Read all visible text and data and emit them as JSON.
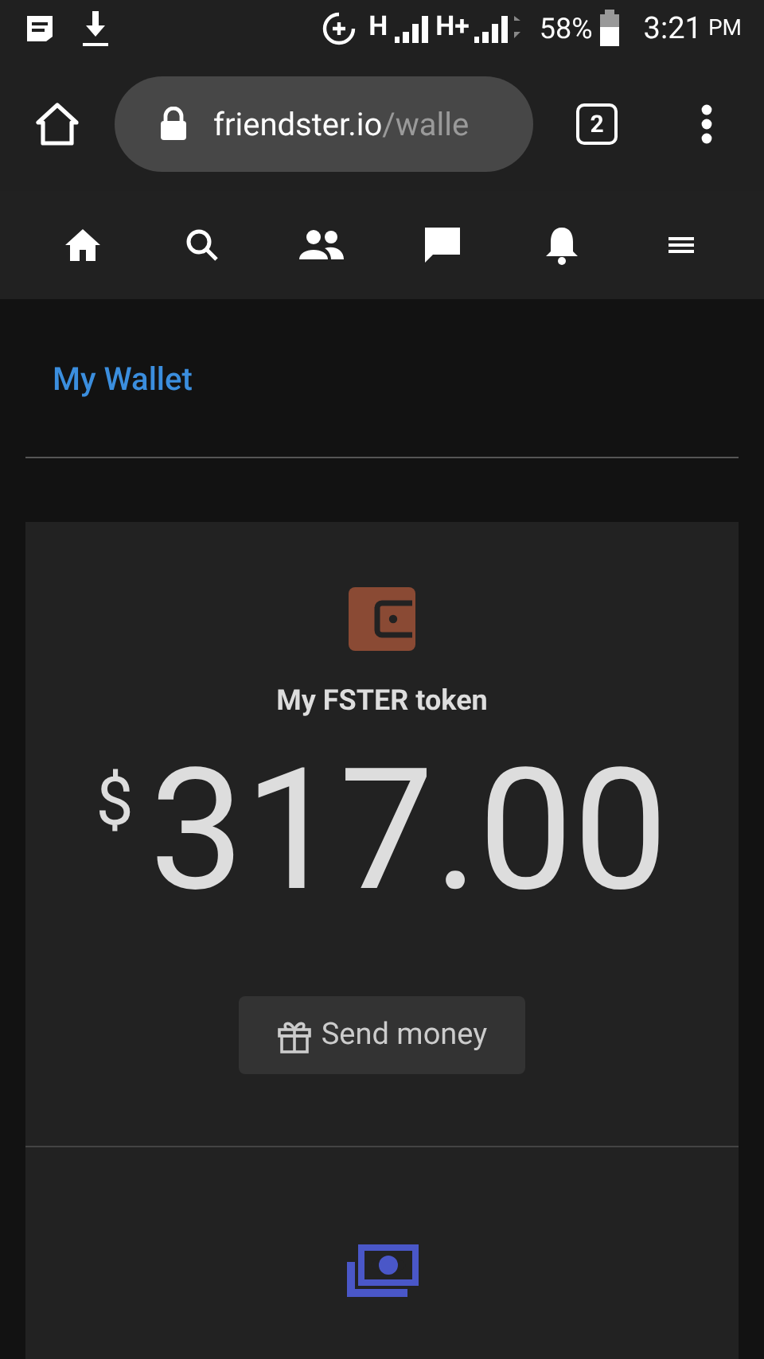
{
  "status_bar": {
    "network_1": "H",
    "network_2": "H+",
    "battery": "58%",
    "time": "3:21",
    "period": "PM"
  },
  "browser": {
    "url_domain": "friendster.io",
    "url_path": "/walle",
    "tab_count": "2"
  },
  "nav": [
    {
      "kind": "home"
    },
    {
      "kind": "search"
    },
    {
      "kind": "friends"
    },
    {
      "kind": "messages"
    },
    {
      "kind": "notifications"
    },
    {
      "kind": "menu"
    }
  ],
  "page": {
    "title": "My Wallet"
  },
  "wallet": {
    "label": "My FSTER token",
    "currency": "$",
    "amount": "317.00",
    "send_button": "Send money"
  }
}
